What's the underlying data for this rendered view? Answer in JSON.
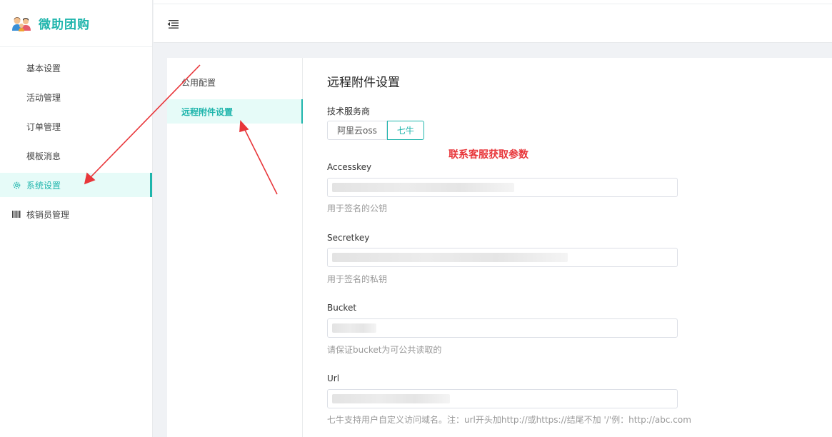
{
  "brand": {
    "title": "微助团购",
    "logo_icon": "people-logo-icon"
  },
  "sidebar": {
    "items": [
      {
        "label": "基本设置",
        "icon": "",
        "active": false
      },
      {
        "label": "活动管理",
        "icon": "",
        "active": false
      },
      {
        "label": "订单管理",
        "icon": "",
        "active": false
      },
      {
        "label": "模板消息",
        "icon": "",
        "active": false
      },
      {
        "label": "系统设置",
        "icon": "gear-icon",
        "active": true
      },
      {
        "label": "核销员管理",
        "icon": "barcode-icon",
        "active": false
      }
    ]
  },
  "header": {
    "menu_toggle_icon": "menu-fold-icon"
  },
  "subnav": {
    "items": [
      {
        "label": "公用配置",
        "active": false
      },
      {
        "label": "远程附件设置",
        "active": true
      }
    ]
  },
  "form": {
    "title": "远程附件设置",
    "provider_label": "技术服务商",
    "providers": [
      "阿里云oss",
      "七牛"
    ],
    "selected_provider": "七牛",
    "notice": "联系客服获取参数",
    "fields": [
      {
        "label": "Accesskey",
        "value": "",
        "hint": "用于签名的公钥"
      },
      {
        "label": "Secretkey",
        "value": "",
        "hint": "用于签名的私钥"
      },
      {
        "label": "Bucket",
        "value": "",
        "hint": "请保证bucket为可公共读取的"
      },
      {
        "label": "Url",
        "value": "",
        "hint": "七牛支持用户自定义访问域名。注：url开头加http://或https://结尾不加 '/'例：http://abc.com"
      }
    ]
  },
  "colors": {
    "accent": "#1fb5ac",
    "annotation": "#e8363a"
  }
}
